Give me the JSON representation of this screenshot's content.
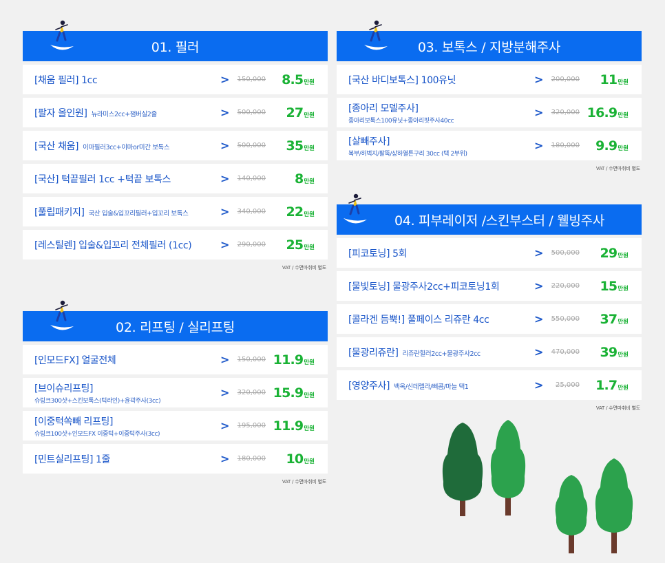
{
  "colors": {
    "header_blue": "#0a6cf0",
    "price_green": "#1ab235",
    "text_blue": "#1a56c9",
    "background": "#f1f1f1"
  },
  "vat_note": "VAT / 수면마취비 별도",
  "unit": "만원",
  "arrow": ">",
  "panels": [
    {
      "title": "01. 필러",
      "items": [
        {
          "name": "[채움 필러] 1cc",
          "detail": "",
          "old_price": "150,000",
          "price": "8.5"
        },
        {
          "name": "[팔자 올인원]",
          "detail": "뉴라미스2cc+잼버실2줄",
          "old_price": "500,000",
          "price": "27"
        },
        {
          "name": "[국산 채움]",
          "detail": "이마필러3cc+이마or미간 보톡스",
          "old_price": "500,000",
          "price": "35"
        },
        {
          "name": "[국산] 턱끝필러 1cc +턱끝 보톡스",
          "detail": "",
          "old_price": "140,000",
          "price": "8"
        },
        {
          "name": "[풀립패키지]",
          "detail": "국산 입술&입꼬리필러+입꼬리 보톡스",
          "old_price": "340,000",
          "price": "22"
        },
        {
          "name": "[레스틸렌] 입술&입꼬리 전체필러 (1cc)",
          "detail": "",
          "old_price": "290,000",
          "price": "25"
        }
      ]
    },
    {
      "title": "02. 리프팅 / 실리프팅",
      "items": [
        {
          "name": "[인모드FX] 얼굴전체",
          "detail": "",
          "old_price": "150,000",
          "price": "11.9"
        },
        {
          "name": "[브이슈리프팅]",
          "detail": "슈링크300샷+스킨보톡스(턱라인)+윤곽주사(3cc)",
          "old_price": "320,000",
          "price": "15.9"
        },
        {
          "name": "[이중턱쏙빼 리프팅]",
          "detail": "슈링크100샷+인모드FX 이중턱+이중턱주사(3cc)",
          "old_price": "195,000",
          "price": "11.9"
        },
        {
          "name": "[민트실리프팅] 1줄",
          "detail": "",
          "old_price": "180,000",
          "price": "10"
        }
      ]
    },
    {
      "title": "03. 보톡스 / 지방분해주사",
      "items": [
        {
          "name": "[국산 바디보톡스] 100유닛",
          "detail": "",
          "old_price": "200,000",
          "price": "11"
        },
        {
          "name": "[종아리 모델주사]",
          "detail": "종아리보톡스100유닛+종아리핏주사40cc",
          "old_price": "320,000",
          "price": "16.9"
        },
        {
          "name": "[살빼주사]",
          "detail": "복부/허벅지/팔뚝/상하열튼구리 30cc (택 2부위)",
          "old_price": "180,000",
          "price": "9.9"
        }
      ]
    },
    {
      "title": "04. 피부레이저 /스킨부스터 / 웰빙주사",
      "items": [
        {
          "name": "[피코토닝] 5회",
          "detail": "",
          "old_price": "500,000",
          "price": "29"
        },
        {
          "name": "[물빛토닝] 물광주사2cc+피코토닝1회",
          "detail": "",
          "old_price": "220,000",
          "price": "15"
        },
        {
          "name": "[콜라겐 듬뿍!] 풀페이스 리쥬란 4cc",
          "detail": "",
          "old_price": "550,000",
          "price": "37"
        },
        {
          "name": "[물광리쥬란]",
          "detail": "리쥬란힐러2cc+물광주사2cc",
          "old_price": "470,000",
          "price": "39"
        },
        {
          "name": "[영양주사]",
          "detail": "백옥/신데렐라/삐콤/마늘 택1",
          "old_price": "25,000",
          "price": "1.7"
        }
      ]
    }
  ]
}
